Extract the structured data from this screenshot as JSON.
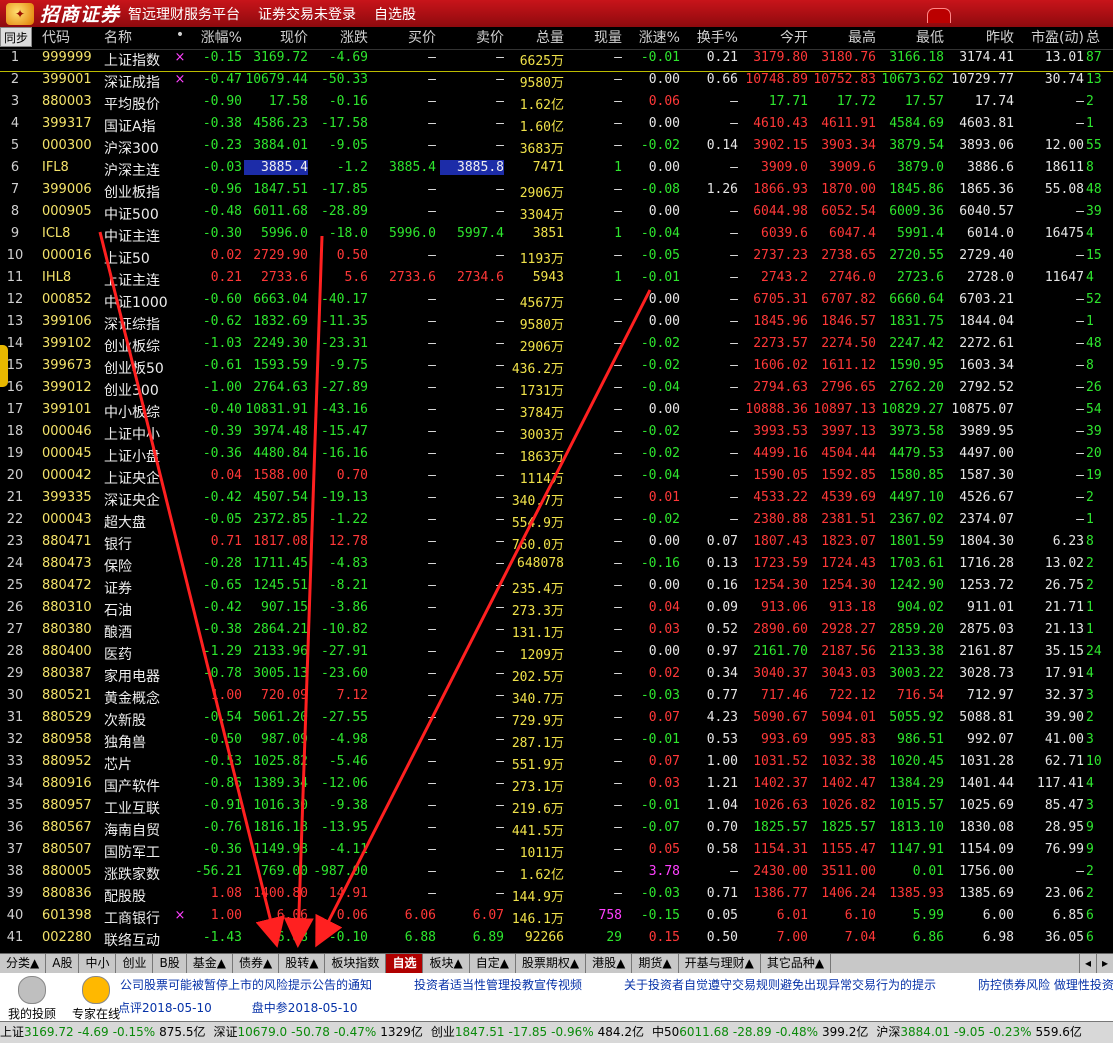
{
  "title": {
    "brand": "招商证券",
    "subtitle": "智远理财服务平台",
    "menu": [
      "证券交易未登录",
      "自选股"
    ]
  },
  "columns": [
    "代码",
    "名称",
    "•",
    "涨幅%",
    "现价",
    "涨跌",
    "买价",
    "卖价",
    "总量",
    "现量",
    "涨速%",
    "换手%",
    "今开",
    "最高",
    "最低",
    "昨收",
    "市盈(动)",
    "总"
  ],
  "sync_label": "同步",
  "rows": [
    [
      "1",
      "999999",
      "上证指数",
      "×",
      "-0.15",
      "3169.72",
      "-4.69",
      "–",
      "–",
      "6625万",
      "–",
      "-0.01",
      "0.21",
      "3179.80",
      "3180.76",
      "3166.18",
      "3174.41",
      "13.01",
      "87"
    ],
    [
      "2",
      "399001",
      "深证成指",
      "×",
      "-0.47",
      "10679.44",
      "-50.33",
      "–",
      "–",
      "9580万",
      "–",
      "0.00",
      "0.66",
      "10748.89",
      "10752.83",
      "10673.62",
      "10729.77",
      "30.74",
      "13"
    ],
    [
      "3",
      "880003",
      "平均股价",
      "",
      "-0.90",
      "17.58",
      "-0.16",
      "–",
      "–",
      "1.62亿",
      "–",
      "0.06",
      "–",
      "17.71",
      "17.72",
      "17.57",
      "17.74",
      "–",
      "2"
    ],
    [
      "4",
      "399317",
      "国证A指",
      "",
      "-0.38",
      "4586.23",
      "-17.58",
      "–",
      "–",
      "1.60亿",
      "–",
      "0.00",
      "–",
      "4610.43",
      "4611.91",
      "4584.69",
      "4603.81",
      "–",
      "1"
    ],
    [
      "5",
      "000300",
      "沪深300",
      "",
      "-0.23",
      "3884.01",
      "-9.05",
      "–",
      "–",
      "3683万",
      "–",
      "-0.02",
      "0.14",
      "3902.15",
      "3903.34",
      "3879.54",
      "3893.06",
      "12.00",
      "55"
    ],
    [
      "6",
      "IFL8",
      "沪深主连",
      "",
      "-0.03",
      "3885.4",
      "-1.2",
      "3885.4",
      "3885.8",
      "7471",
      "1",
      "0.00",
      "–",
      "3909.0",
      "3909.6",
      "3879.0",
      "3886.6",
      "18611",
      "8"
    ],
    [
      "7",
      "399006",
      "创业板指",
      "",
      "-0.96",
      "1847.51",
      "-17.85",
      "–",
      "–",
      "2906万",
      "–",
      "-0.08",
      "1.26",
      "1866.93",
      "1870.00",
      "1845.86",
      "1865.36",
      "55.08",
      "48"
    ],
    [
      "8",
      "000905",
      "中证500",
      "",
      "-0.48",
      "6011.68",
      "-28.89",
      "–",
      "–",
      "3304万",
      "–",
      "0.00",
      "–",
      "6044.98",
      "6052.54",
      "6009.36",
      "6040.57",
      "–",
      "39"
    ],
    [
      "9",
      "ICL8",
      "中证主连",
      "",
      "-0.30",
      "5996.0",
      "-18.0",
      "5996.0",
      "5997.4",
      "3851",
      "1",
      "-0.04",
      "–",
      "6039.6",
      "6047.4",
      "5991.4",
      "6014.0",
      "16475",
      "4"
    ],
    [
      "10",
      "000016",
      "上证50",
      "",
      "0.02",
      "2729.90",
      "0.50",
      "–",
      "–",
      "1193万",
      "–",
      "-0.05",
      "–",
      "2737.23",
      "2738.65",
      "2720.55",
      "2729.40",
      "–",
      "15"
    ],
    [
      "11",
      "IHL8",
      "上证主连",
      "",
      "0.21",
      "2733.6",
      "5.6",
      "2733.6",
      "2734.6",
      "5943",
      "1",
      "-0.01",
      "–",
      "2743.2",
      "2746.0",
      "2723.6",
      "2728.0",
      "11647",
      "4"
    ],
    [
      "12",
      "000852",
      "中证1000",
      "",
      "-0.60",
      "6663.04",
      "-40.17",
      "–",
      "–",
      "4567万",
      "–",
      "0.00",
      "–",
      "6705.31",
      "6707.82",
      "6660.64",
      "6703.21",
      "–",
      "52"
    ],
    [
      "13",
      "399106",
      "深证综指",
      "",
      "-0.62",
      "1832.69",
      "-11.35",
      "–",
      "–",
      "9580万",
      "–",
      "0.00",
      "–",
      "1845.96",
      "1846.57",
      "1831.75",
      "1844.04",
      "–",
      "1"
    ],
    [
      "14",
      "399102",
      "创业板综",
      "",
      "-1.03",
      "2249.30",
      "-23.31",
      "–",
      "–",
      "2906万",
      "–",
      "-0.02",
      "–",
      "2273.57",
      "2274.50",
      "2247.42",
      "2272.61",
      "–",
      "48"
    ],
    [
      "15",
      "399673",
      "创业板50",
      "",
      "-0.61",
      "1593.59",
      "-9.75",
      "–",
      "–",
      "436.2万",
      "–",
      "-0.02",
      "–",
      "1606.02",
      "1611.12",
      "1590.95",
      "1603.34",
      "–",
      "8"
    ],
    [
      "16",
      "399012",
      "创业300",
      "",
      "-1.00",
      "2764.63",
      "-27.89",
      "–",
      "–",
      "1731万",
      "–",
      "-0.04",
      "–",
      "2794.63",
      "2796.65",
      "2762.20",
      "2792.52",
      "–",
      "26"
    ],
    [
      "17",
      "399101",
      "中小板综",
      "",
      "-0.40",
      "10831.91",
      "-43.16",
      "–",
      "–",
      "3784万",
      "–",
      "0.00",
      "–",
      "10888.36",
      "10897.13",
      "10829.27",
      "10875.07",
      "–",
      "54"
    ],
    [
      "18",
      "000046",
      "上证中小",
      "",
      "-0.39",
      "3974.48",
      "-15.47",
      "–",
      "–",
      "3003万",
      "–",
      "-0.02",
      "–",
      "3993.53",
      "3997.13",
      "3973.58",
      "3989.95",
      "–",
      "39"
    ],
    [
      "19",
      "000045",
      "上证小盘",
      "",
      "-0.36",
      "4480.84",
      "-16.16",
      "–",
      "–",
      "1863万",
      "–",
      "-0.02",
      "–",
      "4499.16",
      "4504.44",
      "4479.53",
      "4497.00",
      "–",
      "20"
    ],
    [
      "20",
      "000042",
      "上证央企",
      "",
      "0.04",
      "1588.00",
      "0.70",
      "–",
      "–",
      "1114万",
      "–",
      "-0.04",
      "–",
      "1590.05",
      "1592.85",
      "1580.85",
      "1587.30",
      "–",
      "19"
    ],
    [
      "21",
      "399335",
      "深证央企",
      "",
      "-0.42",
      "4507.54",
      "-19.13",
      "–",
      "–",
      "340.7万",
      "–",
      "0.01",
      "–",
      "4533.22",
      "4539.69",
      "4497.10",
      "4526.67",
      "–",
      "2"
    ],
    [
      "22",
      "000043",
      "超大盘",
      "",
      "-0.05",
      "2372.85",
      "-1.22",
      "–",
      "–",
      "554.9万",
      "–",
      "-0.02",
      "–",
      "2380.88",
      "2381.51",
      "2367.02",
      "2374.07",
      "–",
      "1"
    ],
    [
      "23",
      "880471",
      "银行",
      "",
      "0.71",
      "1817.08",
      "12.78",
      "–",
      "–",
      "760.0万",
      "–",
      "0.00",
      "0.07",
      "1807.43",
      "1823.07",
      "1801.59",
      "1804.30",
      "6.23",
      "8"
    ],
    [
      "24",
      "880473",
      "保险",
      "",
      "-0.28",
      "1711.45",
      "-4.83",
      "–",
      "–",
      "648078",
      "–",
      "-0.16",
      "0.13",
      "1723.59",
      "1724.43",
      "1703.61",
      "1716.28",
      "13.02",
      "2"
    ],
    [
      "25",
      "880472",
      "证券",
      "",
      "-0.65",
      "1245.51",
      "-8.21",
      "–",
      "–",
      "235.4万",
      "–",
      "0.00",
      "0.16",
      "1254.30",
      "1254.30",
      "1242.90",
      "1253.72",
      "26.75",
      "2"
    ],
    [
      "26",
      "880310",
      "石油",
      "",
      "-0.42",
      "907.15",
      "-3.86",
      "–",
      "–",
      "273.3万",
      "–",
      "0.04",
      "0.09",
      "913.06",
      "913.18",
      "904.02",
      "911.01",
      "21.71",
      "1"
    ],
    [
      "27",
      "880380",
      "酿酒",
      "",
      "-0.38",
      "2864.21",
      "-10.82",
      "–",
      "–",
      "131.1万",
      "–",
      "0.03",
      "0.52",
      "2890.60",
      "2928.27",
      "2859.20",
      "2875.03",
      "21.13",
      "1"
    ],
    [
      "28",
      "880400",
      "医药",
      "",
      "-1.29",
      "2133.96",
      "-27.91",
      "–",
      "–",
      "1209万",
      "–",
      "0.00",
      "0.97",
      "2161.70",
      "2187.56",
      "2133.38",
      "2161.87",
      "35.15",
      "24"
    ],
    [
      "29",
      "880387",
      "家用电器",
      "",
      "-0.78",
      "3005.13",
      "-23.60",
      "–",
      "–",
      "202.5万",
      "–",
      "0.02",
      "0.34",
      "3040.37",
      "3043.03",
      "3003.22",
      "3028.73",
      "17.91",
      "4"
    ],
    [
      "30",
      "880521",
      "黄金概念",
      "",
      "1.00",
      "720.09",
      "7.12",
      "–",
      "–",
      "340.7万",
      "–",
      "-0.03",
      "0.77",
      "717.46",
      "722.12",
      "716.54",
      "712.97",
      "32.37",
      "3"
    ],
    [
      "31",
      "880529",
      "次新股",
      "",
      "-0.54",
      "5061.20",
      "-27.55",
      "–",
      "–",
      "729.9万",
      "–",
      "0.07",
      "4.23",
      "5090.67",
      "5094.01",
      "5055.92",
      "5088.81",
      "39.90",
      "2"
    ],
    [
      "32",
      "880958",
      "独角兽",
      "",
      "-0.50",
      "987.09",
      "-4.98",
      "–",
      "–",
      "287.1万",
      "–",
      "-0.01",
      "0.53",
      "993.69",
      "995.83",
      "986.51",
      "992.07",
      "41.00",
      "3"
    ],
    [
      "33",
      "880952",
      "芯片",
      "",
      "-0.53",
      "1025.82",
      "-5.46",
      "–",
      "–",
      "551.9万",
      "–",
      "0.07",
      "1.00",
      "1031.52",
      "1032.38",
      "1020.45",
      "1031.28",
      "62.71",
      "10"
    ],
    [
      "34",
      "880916",
      "国产软件",
      "",
      "-0.86",
      "1389.34",
      "-12.06",
      "–",
      "–",
      "273.1万",
      "–",
      "0.03",
      "1.21",
      "1402.37",
      "1402.47",
      "1384.29",
      "1401.44",
      "117.41",
      "4"
    ],
    [
      "35",
      "880957",
      "工业互联",
      "",
      "-0.91",
      "1016.30",
      "-9.38",
      "–",
      "–",
      "219.6万",
      "–",
      "-0.01",
      "1.04",
      "1026.63",
      "1026.82",
      "1015.57",
      "1025.69",
      "85.47",
      "3"
    ],
    [
      "36",
      "880567",
      "海南自贸",
      "",
      "-0.76",
      "1816.18",
      "-13.95",
      "–",
      "–",
      "441.5万",
      "–",
      "-0.07",
      "0.70",
      "1825.57",
      "1825.57",
      "1813.10",
      "1830.08",
      "28.95",
      "9"
    ],
    [
      "37",
      "880507",
      "国防军工",
      "",
      "-0.36",
      "1149.98",
      "-4.11",
      "–",
      "–",
      "1011万",
      "–",
      "0.05",
      "0.58",
      "1154.31",
      "1155.47",
      "1147.91",
      "1154.09",
      "76.99",
      "9"
    ],
    [
      "38",
      "880005",
      "涨跌家数",
      "",
      "-56.21",
      "769.00",
      "-987.00",
      "–",
      "–",
      "1.62亿",
      "–",
      "3.78",
      "–",
      "2430.00",
      "3511.00",
      "0.01",
      "1756.00",
      "–",
      "2"
    ],
    [
      "39",
      "880836",
      "配股股",
      "",
      "1.08",
      "1400.80",
      "14.91",
      "–",
      "–",
      "144.9万",
      "–",
      "-0.03",
      "0.71",
      "1386.77",
      "1406.24",
      "1385.93",
      "1385.69",
      "23.06",
      "2"
    ],
    [
      "40",
      "601398",
      "工商银行",
      "×",
      "1.00",
      "6.06",
      "0.06",
      "6.06",
      "6.07",
      "146.1万",
      "758",
      "-0.15",
      "0.05",
      "6.01",
      "6.10",
      "5.99",
      "6.00",
      "6.85",
      "6"
    ],
    [
      "41",
      "002280",
      "联络互动",
      "",
      "-1.43",
      "6.88",
      "-0.10",
      "6.88",
      "6.89",
      "92266",
      "29",
      "0.15",
      "0.50",
      "7.00",
      "7.04",
      "6.86",
      "6.98",
      "36.05",
      "6"
    ]
  ],
  "tabs": [
    "分类▲",
    "A股",
    "中小",
    "创业",
    "B股",
    "基金▲",
    "债券▲",
    "股转▲",
    "板块指数",
    "自选",
    "板块▲",
    "自定▲",
    "股票期权▲",
    "港股▲",
    "期货▲",
    "开基与理财▲",
    "其它品种▲"
  ],
  "active_tab": "自选",
  "info_buttons": [
    "我的投顾",
    "专家在线"
  ],
  "news": [
    "公司股票可能被暂停上市的风险提示公告的通知",
    "投资者适当性管理投教宣传视频",
    "关于投资者自觉遵守交易规则避免出现异常交易行为的提示",
    "防控债券风险 做理性投资"
  ],
  "reviews": [
    "点评2018-05-10",
    "盘中参2018-05-10"
  ],
  "status": [
    {
      "name": "上证",
      "price": "3169.72",
      "chg": "-4.69",
      "pct": "-0.15%",
      "amt": "875.5亿"
    },
    {
      "name": "深证",
      "price": "10679.0",
      "chg": "-50.78",
      "pct": "-0.47%",
      "amt": "1329亿"
    },
    {
      "name": "创业",
      "price": "1847.51",
      "chg": "-17.85",
      "pct": "-0.96%",
      "amt": "484.2亿"
    },
    {
      "name": "中50",
      "price": "6011.68",
      "chg": "-28.89",
      "pct": "-0.48%",
      "amt": "399.2亿"
    },
    {
      "name": "沪深",
      "price": "3884.01",
      "chg": "-9.05",
      "pct": "-0.23%",
      "amt": "559.6亿"
    }
  ],
  "colors": {
    "up": "#ff3838",
    "down": "#2ee62e",
    "code": "#f4e36a",
    "highlight": "#1c2ca8",
    "arrow": "#ff2020"
  }
}
